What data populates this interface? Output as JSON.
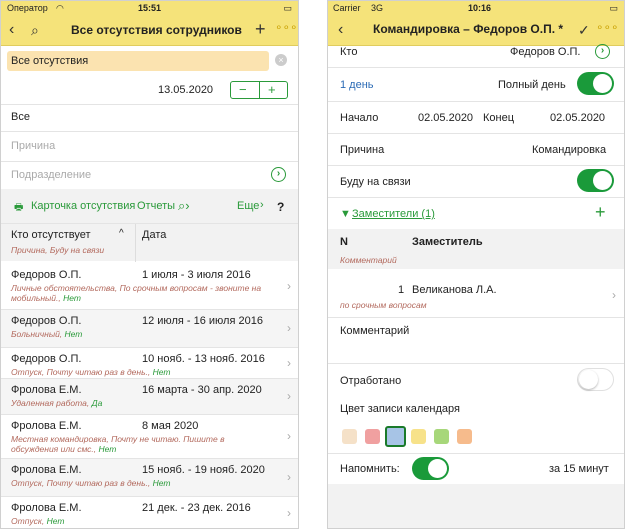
{
  "left": {
    "status": {
      "carrier": "Оператор",
      "time": "15:51"
    },
    "title": "Все отсутствия сотрудников",
    "filter_value": "Все отсутствия",
    "date": "13.05.2020",
    "list_all": "Все",
    "reason_placeholder": "Причина",
    "department_placeholder": "Подразделение",
    "toolbar": {
      "card": "Карточка отсутствия",
      "reports": "Отчеты",
      "more": "Еще",
      "help": "?"
    },
    "columns": {
      "absent": "Кто отсутствует",
      "date": "Дата",
      "sub": "Причина, Буду на связи"
    },
    "rows": [
      {
        "name": "Федоров О.П.",
        "date": "1 июля - 3 июля 2016",
        "sub": "Личные обстоятельства, По срочным вопросам - звоните на",
        "sub2": "мобильный., ",
        "flag": "Нет"
      },
      {
        "name": "Федоров О.П.",
        "date": "12 июля - 16 июля 2016",
        "sub": "Больничный, ",
        "flag": "Нет"
      },
      {
        "name": "Федоров О.П.",
        "date": "10 нояб. - 13 нояб. 2016",
        "sub": "Отпуск, Почту читаю раз в день., ",
        "flag": "Нет"
      },
      {
        "name": "Фролова Е.М.",
        "date": "16 марта - 30 апр. 2020",
        "sub": "Удаленная работа, ",
        "flag": "Да"
      },
      {
        "name": "Фролова Е.М.",
        "date": "8 мая 2020",
        "sub": "Местная командировка, Почту не читаю. Пишите в",
        "sub2": "обсуждения или смс., ",
        "flag": "Нет"
      },
      {
        "name": "Фролова Е.М.",
        "date": "15 нояб. - 19 нояб. 2020",
        "sub": "Отпуск, Почту читаю раз в день., ",
        "flag": "Нет"
      },
      {
        "name": "Фролова Е.М.",
        "date": "21 дек. - 23 дек. 2016",
        "sub": "Отпуск, ",
        "flag": "Нет"
      }
    ]
  },
  "right": {
    "status": {
      "carrier": "Carrier",
      "network": "3G",
      "time": "10:16"
    },
    "title": "Командировка – Федоров О.П. *",
    "who_label": "Кто",
    "who_value": "Федоров О.П.",
    "days": "1 день",
    "full_day": "Полный день",
    "start_label": "Начало",
    "start_value": "02.05.2020",
    "end_label": "Конец",
    "end_value": "02.05.2020",
    "reason_label": "Причина",
    "reason_value": "Командировка",
    "on_call": "Буду на связи",
    "deputies": "Заместители (1)",
    "deputies_col_n": "N",
    "deputies_col_name": "Заместитель",
    "deputies_col_comment": "Комментарий",
    "deputy_n": "1",
    "deputy_name": "Великанова Л.А.",
    "deputy_comment": "по срочным вопросам",
    "comment_label": "Комментарий",
    "worked_off": "Отработано",
    "calendar_color": "Цвет записи календаря",
    "swatches": [
      "#f5e1c8",
      "#f0a0a0",
      "#a7c4e6",
      "#f7e28a",
      "#a7d77a",
      "#f6bb8c"
    ],
    "remind": "Напомнить:",
    "remind_value": "за 15 минут"
  }
}
